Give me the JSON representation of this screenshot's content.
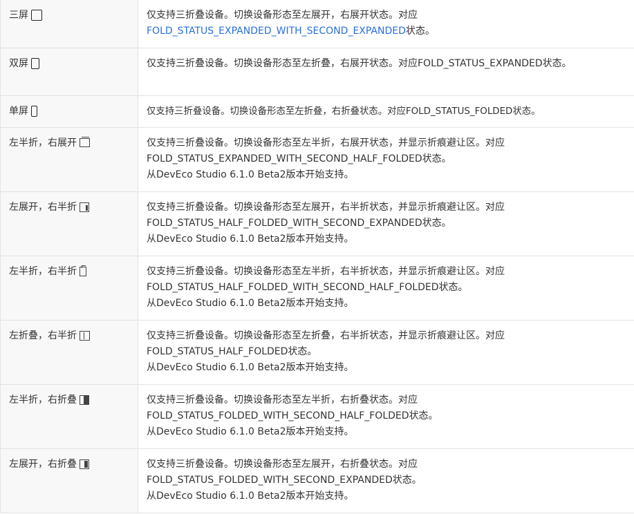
{
  "rows": [
    {
      "mode": "三屏",
      "icon": "tri-screen-icon",
      "lines": [
        "仅支持三折叠设备。切换设备形态至左展开，右展开状态。对应"
      ],
      "link": "FOLD_STATUS_EXPANDED_WITH_SECOND_EXPANDED",
      "link_suffix": "状态。"
    },
    {
      "mode": "双屏",
      "icon": "dual-screen-icon",
      "text": "仅支持三折叠设备。切换设备形态至左折叠，右展开状态。对应FOLD_STATUS_EXPANDED状态。"
    },
    {
      "mode": "单屏",
      "icon": "single-screen-icon",
      "text": "仅支持三折叠设备。切换设备形态至左折叠，右折叠状态。对应FOLD_STATUS_FOLDED状态。"
    },
    {
      "mode": "左半折，右展开",
      "icon": "left-half-right-expanded-icon",
      "lines": [
        "仅支持三折叠设备。切换设备形态至左半折，右展开状态，并显示折痕避让区。对应",
        "FOLD_STATUS_EXPANDED_WITH_SECOND_HALF_FOLDED状态。",
        "从DevEco Studio 6.1.0 Beta2版本开始支持。"
      ]
    },
    {
      "mode": "左展开，右半折",
      "icon": "left-expanded-right-half-icon",
      "lines": [
        "仅支持三折叠设备。切换设备形态至左展开，右半折状态，并显示折痕避让区。对应",
        "FOLD_STATUS_HALF_FOLDED_WITH_SECOND_EXPANDED状态。",
        "从DevEco Studio 6.1.0 Beta2版本开始支持。"
      ]
    },
    {
      "mode": "左半折，右半折",
      "icon": "left-half-right-half-icon",
      "lines": [
        "仅支持三折叠设备。切换设备形态至左半折，右半折状态，并显示折痕避让区。对应",
        "FOLD_STATUS_HALF_FOLDED_WITH_SECOND_HALF_FOLDED状态。",
        "从DevEco Studio 6.1.0 Beta2版本开始支持。"
      ]
    },
    {
      "mode": "左折叠，右半折",
      "icon": "left-folded-right-half-icon",
      "lines": [
        "仅支持三折叠设备。切换设备形态至左折叠，右半折状态，并显示折痕避让区。对应",
        "FOLD_STATUS_HALF_FOLDED状态。",
        "从DevEco Studio 6.1.0 Beta2版本开始支持。"
      ]
    },
    {
      "mode": "左半折，右折叠",
      "icon": "left-half-right-folded-icon",
      "lines": [
        "仅支持三折叠设备。切换设备形态至左半折，右折叠状态。对应",
        "FOLD_STATUS_FOLDED_WITH_SECOND_HALF_FOLDED状态。",
        "从DevEco Studio 6.1.0 Beta2版本开始支持。"
      ]
    },
    {
      "mode": "左展开，右折叠",
      "icon": "left-expanded-right-folded-icon",
      "lines": [
        "仅支持三折叠设备。切换设备形态至左展开，右折叠状态。对应",
        "FOLD_STATUS_FOLDED_WITH_SECOND_EXPANDED状态。",
        "从DevEco Studio 6.1.0 Beta2版本开始支持。"
      ]
    }
  ],
  "colors": {
    "link": "#2a6fdb",
    "text": "#333333",
    "border": "#e3e3e3",
    "mode_bg": "#f8f8f8"
  }
}
